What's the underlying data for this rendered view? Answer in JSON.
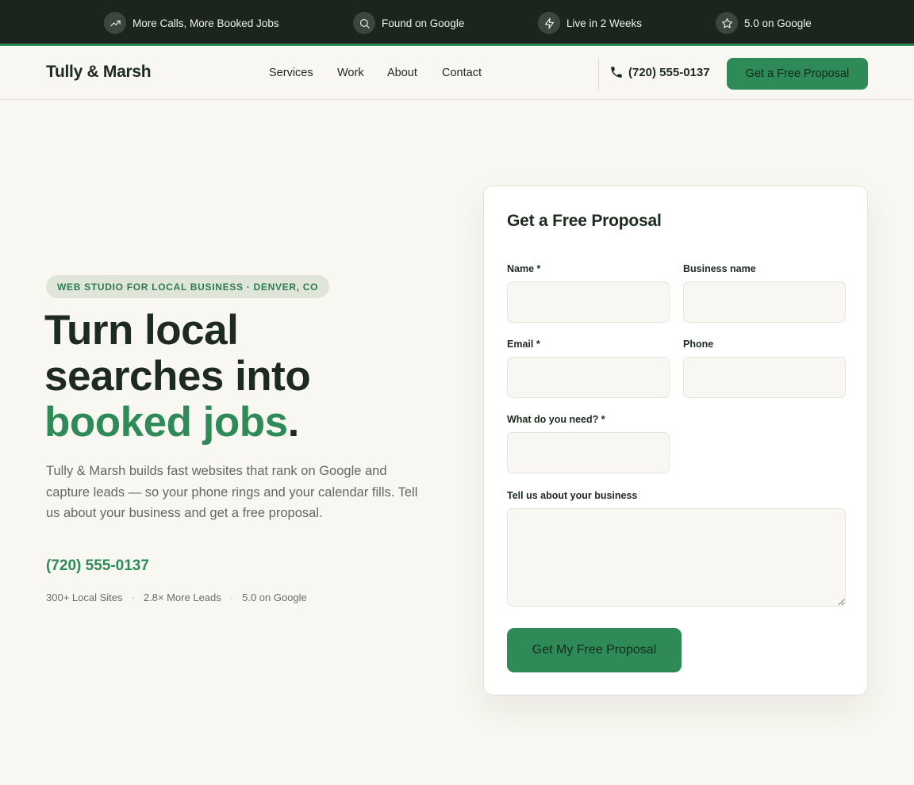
{
  "topbar": {
    "items": [
      {
        "icon": "trending-up-icon",
        "label": "More Calls, More Booked Jobs"
      },
      {
        "icon": "search-icon",
        "label": "Found on Google"
      },
      {
        "icon": "lightning-icon",
        "label": "Live in 2 Weeks"
      },
      {
        "icon": "star-icon",
        "label": "5.0 on Google"
      }
    ]
  },
  "nav": {
    "logo": "Tully & Marsh",
    "links": [
      "Services",
      "Work",
      "About",
      "Contact"
    ],
    "phone": "(720) 555-0137",
    "cta": "Get a Free Proposal"
  },
  "hero": {
    "eyebrow": "WEB STUDIO FOR LOCAL BUSINESS · DENVER, CO",
    "headline_line1": "Turn local",
    "headline_line2": "searches into",
    "headline_accent": "booked jobs",
    "headline_end": ".",
    "lede": "Tully & Marsh builds fast websites that rank on Google and capture leads — so your phone rings and your calendar fills. Tell us about your business and get a free proposal.",
    "phone": "(720) 555-0137",
    "stats": [
      "300+ Local Sites",
      "2.8× More Leads",
      "5.0 on Google"
    ]
  },
  "form": {
    "title": "Get a Free Proposal",
    "name_label": "Name *",
    "name_value": "",
    "business_label": "Business name",
    "business_value": "",
    "email_label": "Email *",
    "email_value": "",
    "phone_label": "Phone",
    "phone_value": "",
    "need_label": "What do you need? *",
    "need_value": "",
    "about_label": "Tell us about your business",
    "about_value": "",
    "submit": "Get My Free Proposal"
  },
  "colors": {
    "brand_green": "#2e8b57",
    "dark": "#1b251d",
    "background": "#f9f7f1"
  }
}
